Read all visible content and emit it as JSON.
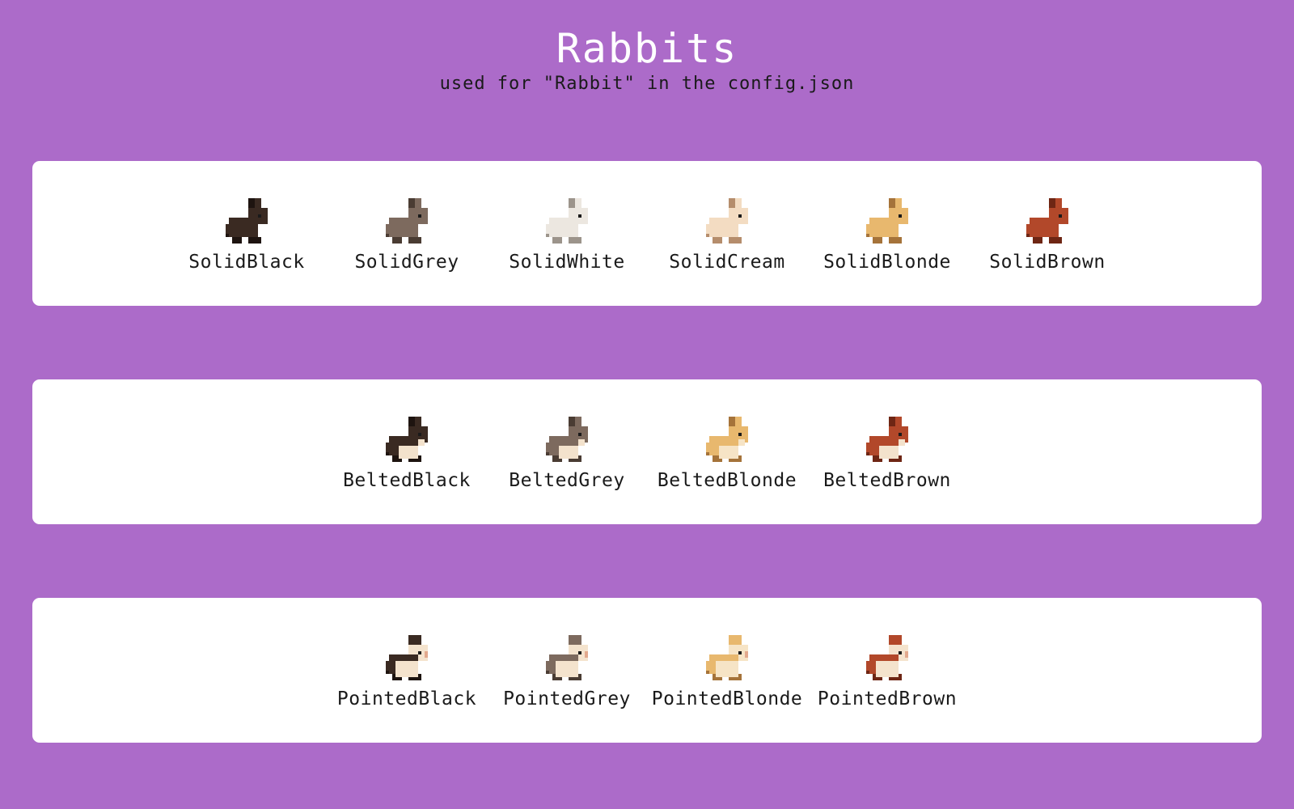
{
  "header": {
    "title": "Rabbits",
    "subtitle": "used for \"Rabbit\" in the config.json"
  },
  "groups": [
    {
      "id": "solid",
      "items": [
        {
          "label": "SolidBlack",
          "pattern": "solid",
          "color": "#3a2a22",
          "shade": "#1e1410",
          "patch": "#3a2a22"
        },
        {
          "label": "SolidGrey",
          "pattern": "solid",
          "color": "#7d6a5e",
          "shade": "#4a3c33",
          "patch": "#7d6a5e"
        },
        {
          "label": "SolidWhite",
          "pattern": "solid",
          "color": "#ece7e0",
          "shade": "#9c948b",
          "patch": "#ece7e0"
        },
        {
          "label": "SolidCream",
          "pattern": "solid",
          "color": "#f3dcc2",
          "shade": "#b58d6c",
          "patch": "#f3dcc2"
        },
        {
          "label": "SolidBlonde",
          "pattern": "solid",
          "color": "#e8b86e",
          "shade": "#a5733a",
          "patch": "#e8b86e"
        },
        {
          "label": "SolidBrown",
          "pattern": "solid",
          "color": "#b2482a",
          "shade": "#6e2614",
          "patch": "#b2482a"
        }
      ]
    },
    {
      "id": "belted",
      "items": [
        {
          "label": "BeltedBlack",
          "pattern": "belted",
          "color": "#3a2a22",
          "shade": "#1e1410",
          "patch": "#f3e2cc"
        },
        {
          "label": "BeltedGrey",
          "pattern": "belted",
          "color": "#7d6a5e",
          "shade": "#4a3c33",
          "patch": "#f3e2cc"
        },
        {
          "label": "BeltedBlonde",
          "pattern": "belted",
          "color": "#e8b86e",
          "shade": "#a5733a",
          "patch": "#f6e4c6"
        },
        {
          "label": "BeltedBrown",
          "pattern": "belted",
          "color": "#b2482a",
          "shade": "#6e2614",
          "patch": "#f3e2cc"
        }
      ]
    },
    {
      "id": "pointed",
      "items": [
        {
          "label": "PointedBlack",
          "pattern": "pointed",
          "color": "#3a2a22",
          "shade": "#1e1410",
          "patch": "#f4e3cd"
        },
        {
          "label": "PointedGrey",
          "pattern": "pointed",
          "color": "#7d6a5e",
          "shade": "#4a3c33",
          "patch": "#f4e3cd"
        },
        {
          "label": "PointedBlonde",
          "pattern": "pointed",
          "color": "#e8b86e",
          "shade": "#a5733a",
          "patch": "#f6e4c6"
        },
        {
          "label": "PointedBrown",
          "pattern": "pointed",
          "color": "#b2482a",
          "shade": "#6e2614",
          "patch": "#f4e3cd"
        }
      ]
    }
  ]
}
